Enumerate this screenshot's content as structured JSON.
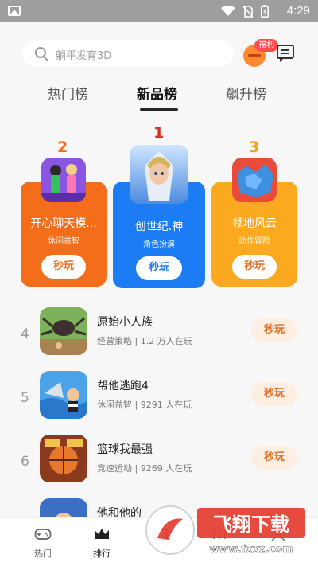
{
  "status_bar": {
    "time": "4:29"
  },
  "search": {
    "placeholder": "躺平发育3D"
  },
  "header": {
    "welfare_badge": "福利"
  },
  "tabs": [
    {
      "label": "热门榜",
      "active": false
    },
    {
      "label": "新品榜",
      "active": true
    },
    {
      "label": "飙升榜",
      "active": false
    }
  ],
  "podium": [
    {
      "rank": "2",
      "name": "开心聊天模...",
      "category": "休闲益智",
      "play_label": "秒玩",
      "color": "#f36d1a",
      "rank_color": "#f36d1a"
    },
    {
      "rank": "1",
      "name": "创世纪.神",
      "category": "角色扮演",
      "play_label": "秒玩",
      "color": "#1b7cf3",
      "rank_color": "#d93025"
    },
    {
      "rank": "3",
      "name": "领地风云",
      "category": "动作冒险",
      "play_label": "秒玩",
      "color": "#fba91f",
      "rank_color": "#f2a51a"
    }
  ],
  "list": [
    {
      "rank": "4",
      "title": "原始小人族",
      "meta": "经营策略 | 1.2 万人在玩",
      "play_label": "秒玩"
    },
    {
      "rank": "5",
      "title": "帮他逃跑4",
      "meta": "休闲益智 | 9291 人在玩",
      "play_label": "秒玩"
    },
    {
      "rank": "6",
      "title": "篮球我最强",
      "meta": "竞速运动 | 9269 人在玩",
      "play_label": "秒玩"
    },
    {
      "rank": "",
      "title": "他和他的",
      "meta": "",
      "play_label": ""
    }
  ],
  "bottom_nav": [
    {
      "label": "热门",
      "icon": "gamepad-icon",
      "active": false
    },
    {
      "label": "排行",
      "icon": "crown-icon",
      "active": true
    },
    {
      "label": "",
      "icon": "nav-icon-3",
      "active": false
    },
    {
      "label": "",
      "icon": "nav-icon-4",
      "active": false
    },
    {
      "label": "",
      "icon": "nav-icon-5",
      "active": false
    }
  ],
  "watermark": {
    "text": "飞翔下载",
    "url_text": "www.fxxz.com"
  },
  "colors": {
    "accent_orange": "#e0712b",
    "play_bg": "#fdeee2"
  }
}
